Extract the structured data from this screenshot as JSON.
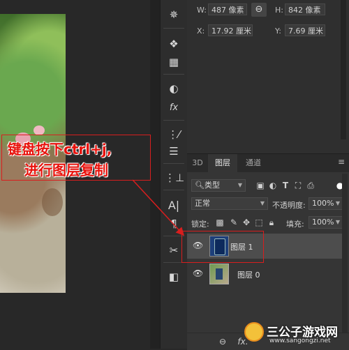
{
  "properties": {
    "width_label": "W:",
    "width_value": "487 像素",
    "height_label": "H:",
    "height_value": "842 像素",
    "x_label": "X:",
    "x_value": "17.92 厘米",
    "y_label": "Y:",
    "y_value": "7.69 厘米"
  },
  "layers_panel": {
    "tabs": [
      "3D",
      "图层",
      "通道"
    ],
    "active_tab": "图层",
    "filter_label": "类型",
    "blend_mode": "正常",
    "opacity_label": "不透明度:",
    "opacity_value": "100%",
    "lock_label": "锁定:",
    "fill_label": "填充:",
    "fill_value": "100%",
    "layers": [
      {
        "name": "图层 1",
        "selected": true
      },
      {
        "name": "图层 0",
        "selected": false
      }
    ],
    "bottom_icon_fx": "fx."
  },
  "annotation": {
    "line1": "键盘按下ctrl+j,",
    "line2": "进行图层复制",
    "color": "#e8120c"
  },
  "watermark": {
    "title": "三公子游戏网",
    "url": "www.sangongzi.net"
  },
  "icons": {
    "tools": [
      "settings-gear-icon",
      "color-swatches-icon",
      "grid-icon",
      "half-circle-icon",
      "fx-icon",
      "brush-settings-icon",
      "sliders-icon",
      "clone-source-icon",
      "character-icon",
      "paragraph-icon",
      "scissors-tools-icon",
      "navigator-icon"
    ]
  }
}
